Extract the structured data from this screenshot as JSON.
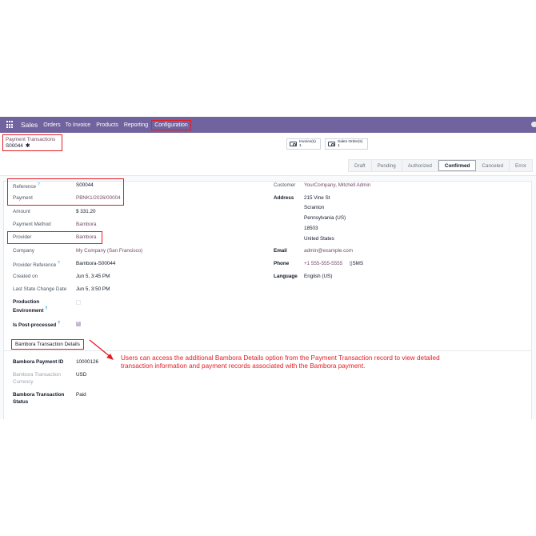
{
  "navbar": {
    "brand": "Sales",
    "items": [
      "Orders",
      "To Invoice",
      "Products",
      "Reporting"
    ],
    "configuration": "Configuration",
    "color": "#71639e"
  },
  "breadcrumb": {
    "parent": "Payment Transactions",
    "record": "S00044"
  },
  "smart_buttons": [
    {
      "label": "Invoice(s)",
      "value": "1"
    },
    {
      "label": "Sales Order(s)",
      "value": "1"
    }
  ],
  "status": {
    "stages": [
      "Draft",
      "Pending",
      "Authorized",
      "Confirmed",
      "Canceled",
      "Error"
    ],
    "active": "Confirmed"
  },
  "left_fields": {
    "reference": {
      "label": "Reference",
      "value": "S00044"
    },
    "payment": {
      "label": "Payment",
      "value": "PBNK1/2026/00004"
    },
    "amount": {
      "label": "Amount",
      "value": "$ 331.20"
    },
    "payment_method": {
      "label": "Payment Method",
      "value": "Bambora"
    },
    "provider": {
      "label": "Provider",
      "value": "Bambora"
    },
    "company": {
      "label": "Company",
      "value": "My Company (San Francisco)"
    },
    "provider_reference": {
      "label": "Provider Reference",
      "value": "Bambora-S00044"
    },
    "created_on": {
      "label": "Created on",
      "value": "Jun 5, 3:45 PM"
    },
    "last_state_change": {
      "label": "Last State Change Date",
      "value": "Jun 5, 3:50 PM"
    },
    "production_environment": {
      "label_line1": "Production",
      "label_line2": "Environment",
      "checked": false
    },
    "is_post_processed": {
      "label": "Is Post-processed",
      "checked": true
    }
  },
  "right_fields": {
    "customer": {
      "label": "Customer",
      "value": "YourCompany, Mitchell Admin"
    },
    "address": {
      "label": "Address",
      "lines": [
        "215 Vine St",
        "Scranton",
        "Pennsylvania (US)",
        "18503",
        "United States"
      ]
    },
    "email": {
      "label": "Email",
      "value": "admin@example.com"
    },
    "phone": {
      "label": "Phone",
      "value": "+1 555-555-5555",
      "sms": "SMS"
    },
    "language": {
      "label": "Language",
      "value": "English (US)"
    }
  },
  "bambora_tab": {
    "title": "Bambora Transaction Details",
    "payment_id": {
      "label": "Bambora Payment ID",
      "value": "10000126"
    },
    "currency": {
      "label_line1": "Bambora Transaction",
      "label_line2": "Currency",
      "value": "USD"
    },
    "status": {
      "label_line1": "Bambora Transaction",
      "label_line2": "Status",
      "value": "Paid"
    }
  },
  "annotation": "Users can access the additional Bambora Details option from the Payment Transaction record to view detailed transaction information and payment records associated with the Bambora payment.",
  "tooltip_mark": "?",
  "colors": {
    "highlight": "#e31b23",
    "link": "#714b67",
    "tooltip": "#0ea5e9"
  }
}
